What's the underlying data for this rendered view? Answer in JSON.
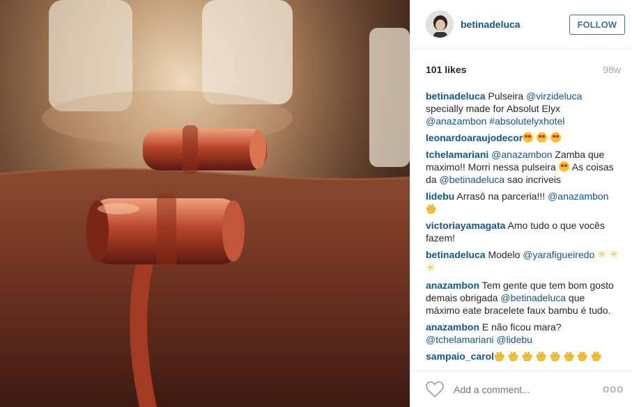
{
  "post": {
    "username": "betinadeluca",
    "follow_label": "FOLLOW",
    "likes": "101 likes",
    "age": "98w"
  },
  "comments": [
    {
      "author": "betinadeluca",
      "parts": [
        {
          "t": "text",
          "v": " Pulseira "
        },
        {
          "t": "link",
          "v": "@virzideluca"
        },
        {
          "t": "text",
          "v": " specially made for Absolut Elyx "
        },
        {
          "t": "link",
          "v": "@anazambon"
        },
        {
          "t": "text",
          "v": " "
        },
        {
          "t": "link",
          "v": "#absolutelyxhotel"
        }
      ]
    },
    {
      "author": "leonardoaraujodecor",
      "parts": [
        {
          "t": "emoji",
          "v": "heart-eyes"
        },
        {
          "t": "emoji",
          "v": "heart-eyes"
        },
        {
          "t": "emoji",
          "v": "heart-eyes"
        }
      ]
    },
    {
      "author": "tchelamariani",
      "parts": [
        {
          "t": "text",
          "v": " "
        },
        {
          "t": "link",
          "v": "@anazambon"
        },
        {
          "t": "text",
          "v": " Zamba que maximo!! Morri nessa pulseira "
        },
        {
          "t": "emoji",
          "v": "heart-eyes"
        },
        {
          "t": "text",
          "v": " As coisas da "
        },
        {
          "t": "link",
          "v": "@betinadeluca"
        },
        {
          "t": "text",
          "v": " sao incriveis"
        }
      ]
    },
    {
      "author": "lidebu",
      "parts": [
        {
          "t": "text",
          "v": " Arrasô na parceria!!! "
        },
        {
          "t": "link",
          "v": "@anazambon"
        },
        {
          "t": "text",
          "v": " "
        },
        {
          "t": "emoji",
          "v": "clap"
        }
      ]
    },
    {
      "author": "victoriayamagata",
      "parts": [
        {
          "t": "text",
          "v": " Amo tudo o que vocês fazem!"
        }
      ]
    },
    {
      "author": "betinadeluca",
      "parts": [
        {
          "t": "text",
          "v": " Modelo "
        },
        {
          "t": "link",
          "v": "@yarafigueiredo"
        },
        {
          "t": "text",
          "v": " "
        },
        {
          "t": "emoji",
          "v": "star"
        },
        {
          "t": "emoji",
          "v": "star"
        },
        {
          "t": "emoji",
          "v": "star"
        }
      ]
    },
    {
      "author": "anazambon",
      "parts": [
        {
          "t": "text",
          "v": " Tem gente que tem bom gosto demais obrigada "
        },
        {
          "t": "link",
          "v": "@betinadeluca"
        },
        {
          "t": "text",
          "v": " que máximo eate bracelete faux bambu é tudo."
        }
      ]
    },
    {
      "author": "anazambon",
      "parts": [
        {
          "t": "text",
          "v": " E não ficou mara? "
        },
        {
          "t": "link",
          "v": "@tchelamariani"
        },
        {
          "t": "text",
          "v": " "
        },
        {
          "t": "link",
          "v": "@lidebu"
        }
      ]
    },
    {
      "author": "sampaio_carol",
      "parts": [
        {
          "t": "emoji",
          "v": "clap"
        },
        {
          "t": "emoji",
          "v": "clap"
        },
        {
          "t": "emoji",
          "v": "clap"
        },
        {
          "t": "emoji",
          "v": "clap"
        },
        {
          "t": "emoji",
          "v": "clap"
        },
        {
          "t": "emoji",
          "v": "clap"
        },
        {
          "t": "emoji",
          "v": "clap"
        },
        {
          "t": "emoji",
          "v": "clap"
        }
      ]
    }
  ],
  "footer": {
    "comment_placeholder": "Add a comment...",
    "more_label": "ooo",
    "like_icon": "heart-outline-icon"
  },
  "colors": {
    "link": "#125688",
    "follow": "#3f729b",
    "muted": "#a5a7aa"
  }
}
